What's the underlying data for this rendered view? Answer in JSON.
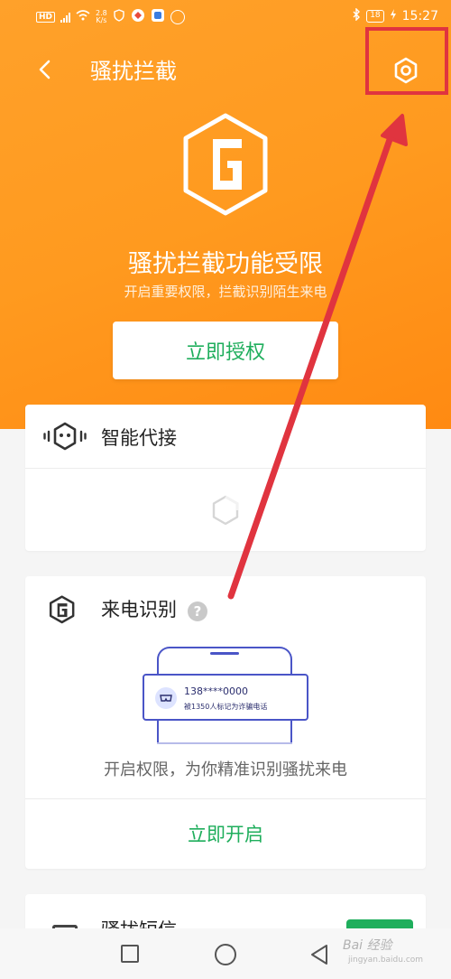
{
  "status_bar": {
    "hd_badge": "HD",
    "net_speed_value": "2.8",
    "net_speed_unit": "K/s",
    "battery": "18",
    "time": "15:27"
  },
  "header": {
    "title": "骚扰拦截",
    "back_icon": "chevron-left-icon",
    "settings_icon": "hexagon-gear-icon"
  },
  "hero": {
    "logo_icon": "hexagon-shield-logo-icon",
    "title": "骚扰拦截功能受限",
    "subtitle": "开启重要权限，拦截识别陌生来电",
    "grant_button": "立即授权"
  },
  "cards": {
    "smart_answer": {
      "title": "智能代接",
      "icon": "robot-voice-icon",
      "loading_icon": "hexagon-spinner-icon"
    },
    "caller_id": {
      "title": "来电识别",
      "help": "?",
      "illustration": {
        "number": "138****0000",
        "tag": "被1350人标记为诈骗电话"
      },
      "description": "开启权限，为你精准识别骚扰来电",
      "open_button": "立即开启"
    },
    "harass_sms": {
      "title": "骚扰短信"
    }
  },
  "navbar": {
    "watermark": "Bai 经验",
    "watermark_sub": "jingyan.baidu.com"
  },
  "colors": {
    "hero_orange": "#ff9a1f",
    "accent_green": "#1fae5c",
    "annotation_red": "#e0343f",
    "illustration_blue": "#4a55c7"
  }
}
